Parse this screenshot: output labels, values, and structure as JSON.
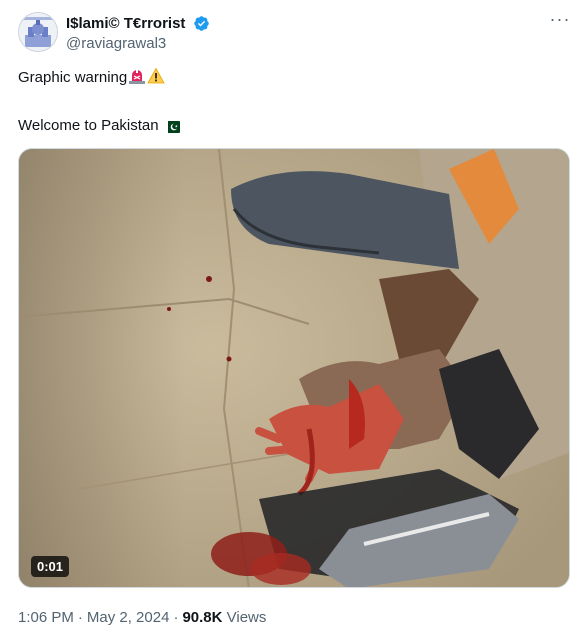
{
  "author": {
    "display_name": "I$lami© T€rrorist",
    "handle": "@raviagrawal3",
    "verified_icon": "verified-badge-icon",
    "avatar": "avatar-image"
  },
  "menu": {
    "more_label": "···"
  },
  "tweet": {
    "line1": "Graphic warning",
    "line1_emojis": [
      "rotating-light-emoji",
      "warning-emoji"
    ],
    "line2": "Welcome to Pakistan",
    "line2_emoji": "pakistan-flag-emoji"
  },
  "media": {
    "type": "video",
    "duration": "0:01"
  },
  "meta": {
    "time": "1:06 PM",
    "separator": "·",
    "date": "May 2, 2024",
    "views_count": "90.8K",
    "views_label": "Views"
  },
  "colors": {
    "accent": "#1d9bf0",
    "secondary_text": "#536471",
    "primary_text": "#0f1419"
  }
}
